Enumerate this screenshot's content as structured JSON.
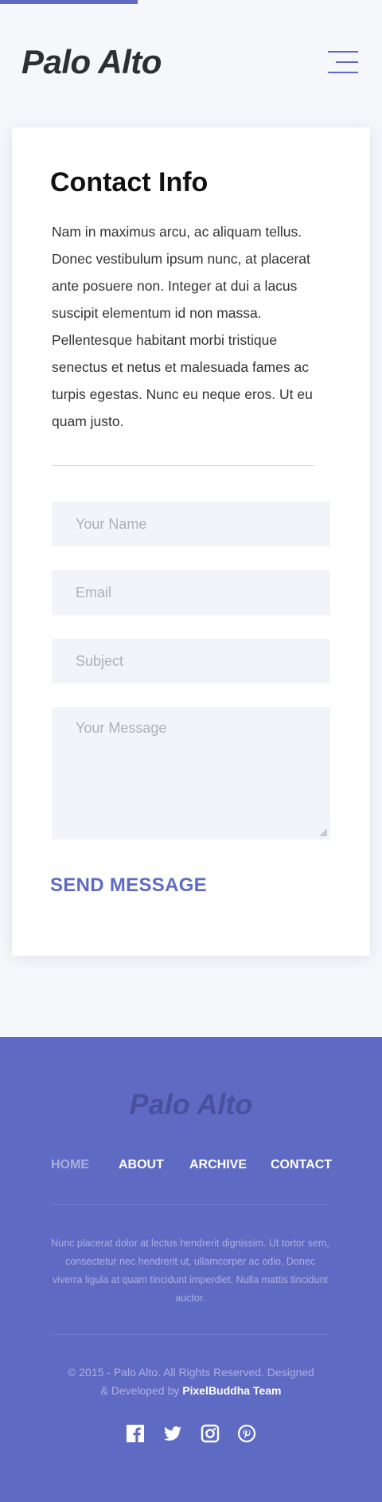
{
  "reading_progress": 0.36,
  "header": {
    "logo": "Palo Alto",
    "menu_icon": "hamburger-menu-icon"
  },
  "contact": {
    "title": "Contact Info",
    "description": "Nam in maximus arcu, ac aliquam tellus. Donec vestibulum ipsum nunc, at placerat ante posuere non. Integer at dui a lacus suscipit elementum id non massa. Pellentesque habitant morbi tristique senectus et netus et malesuada fames ac turpis egestas. Nunc eu neque eros. Ut eu quam justo.",
    "form": {
      "name_placeholder": "Your Name",
      "email_placeholder": "Email",
      "subject_placeholder": "Subject",
      "message_placeholder": "Your Message",
      "submit_label": "SEND MESSAGE"
    }
  },
  "footer": {
    "logo": "Palo Alto",
    "nav": [
      "HOME",
      "ABOUT",
      "ARCHIVE",
      "CONTACT"
    ],
    "active_nav": "HOME",
    "text": "Nunc placerat dolor at lectus hendrerit dignissim. Ut tortor sem, consectetur nec hendrerit ut, ullamcorper ac odio. Donec viverra ligula at quam tincidunt imperdiet. Nulla mattis tincidunt auctor.",
    "copyright_prefix": "© 2015 - Palo Alto. All Rights Reserved. Designed & Developed by ",
    "copyright_link": "PixelBuddha Team",
    "social_icons": [
      "facebook-icon",
      "twitter-icon",
      "instagram-icon",
      "pinterest-icon"
    ]
  },
  "colors": {
    "accent": "#5f6bc2",
    "footer_bg": "#5f6bc2",
    "page_bg": "#f6f7fb"
  }
}
